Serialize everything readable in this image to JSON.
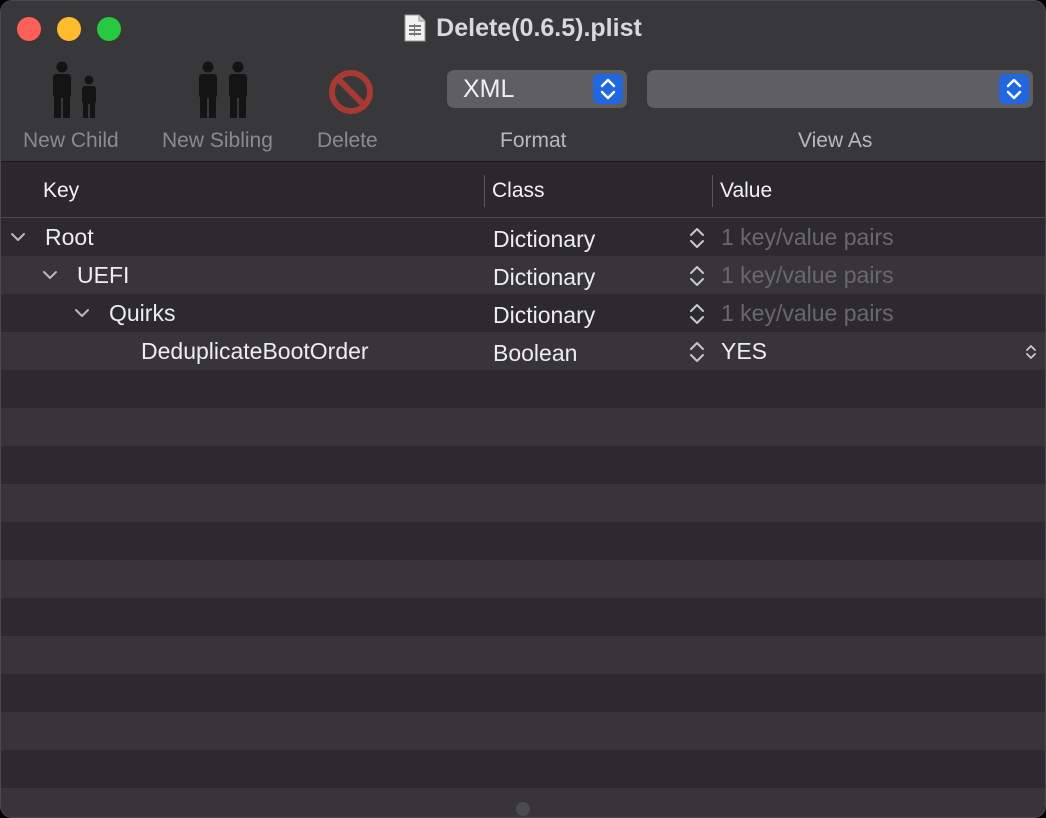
{
  "window": {
    "title": "Delete(0.6.5).plist",
    "controls": [
      "close",
      "minimize",
      "zoom"
    ]
  },
  "toolbar": {
    "new_child": "New Child",
    "new_sibling": "New Sibling",
    "delete": "Delete",
    "format_label": "Format",
    "format_value": "XML",
    "viewas_label": "View As",
    "viewas_value": ""
  },
  "columns": {
    "key": "Key",
    "class": "Class",
    "value": "Value"
  },
  "rows": [
    {
      "key": "Root",
      "class": "Dictionary",
      "value": "1 key/value pairs",
      "expanded": true,
      "level": 0
    },
    {
      "key": "UEFI",
      "class": "Dictionary",
      "value": "1 key/value pairs",
      "expanded": true,
      "level": 1
    },
    {
      "key": "Quirks",
      "class": "Dictionary",
      "value": "1 key/value pairs",
      "expanded": true,
      "level": 2
    },
    {
      "key": "DeduplicateBootOrder",
      "class": "Boolean",
      "value": "YES",
      "level": 3
    }
  ],
  "colors": {
    "accent": "#2167e0",
    "close": "#fe5f57",
    "minimize": "#febc2e",
    "zoom": "#28c840",
    "delete_icon": "#c0392b"
  }
}
